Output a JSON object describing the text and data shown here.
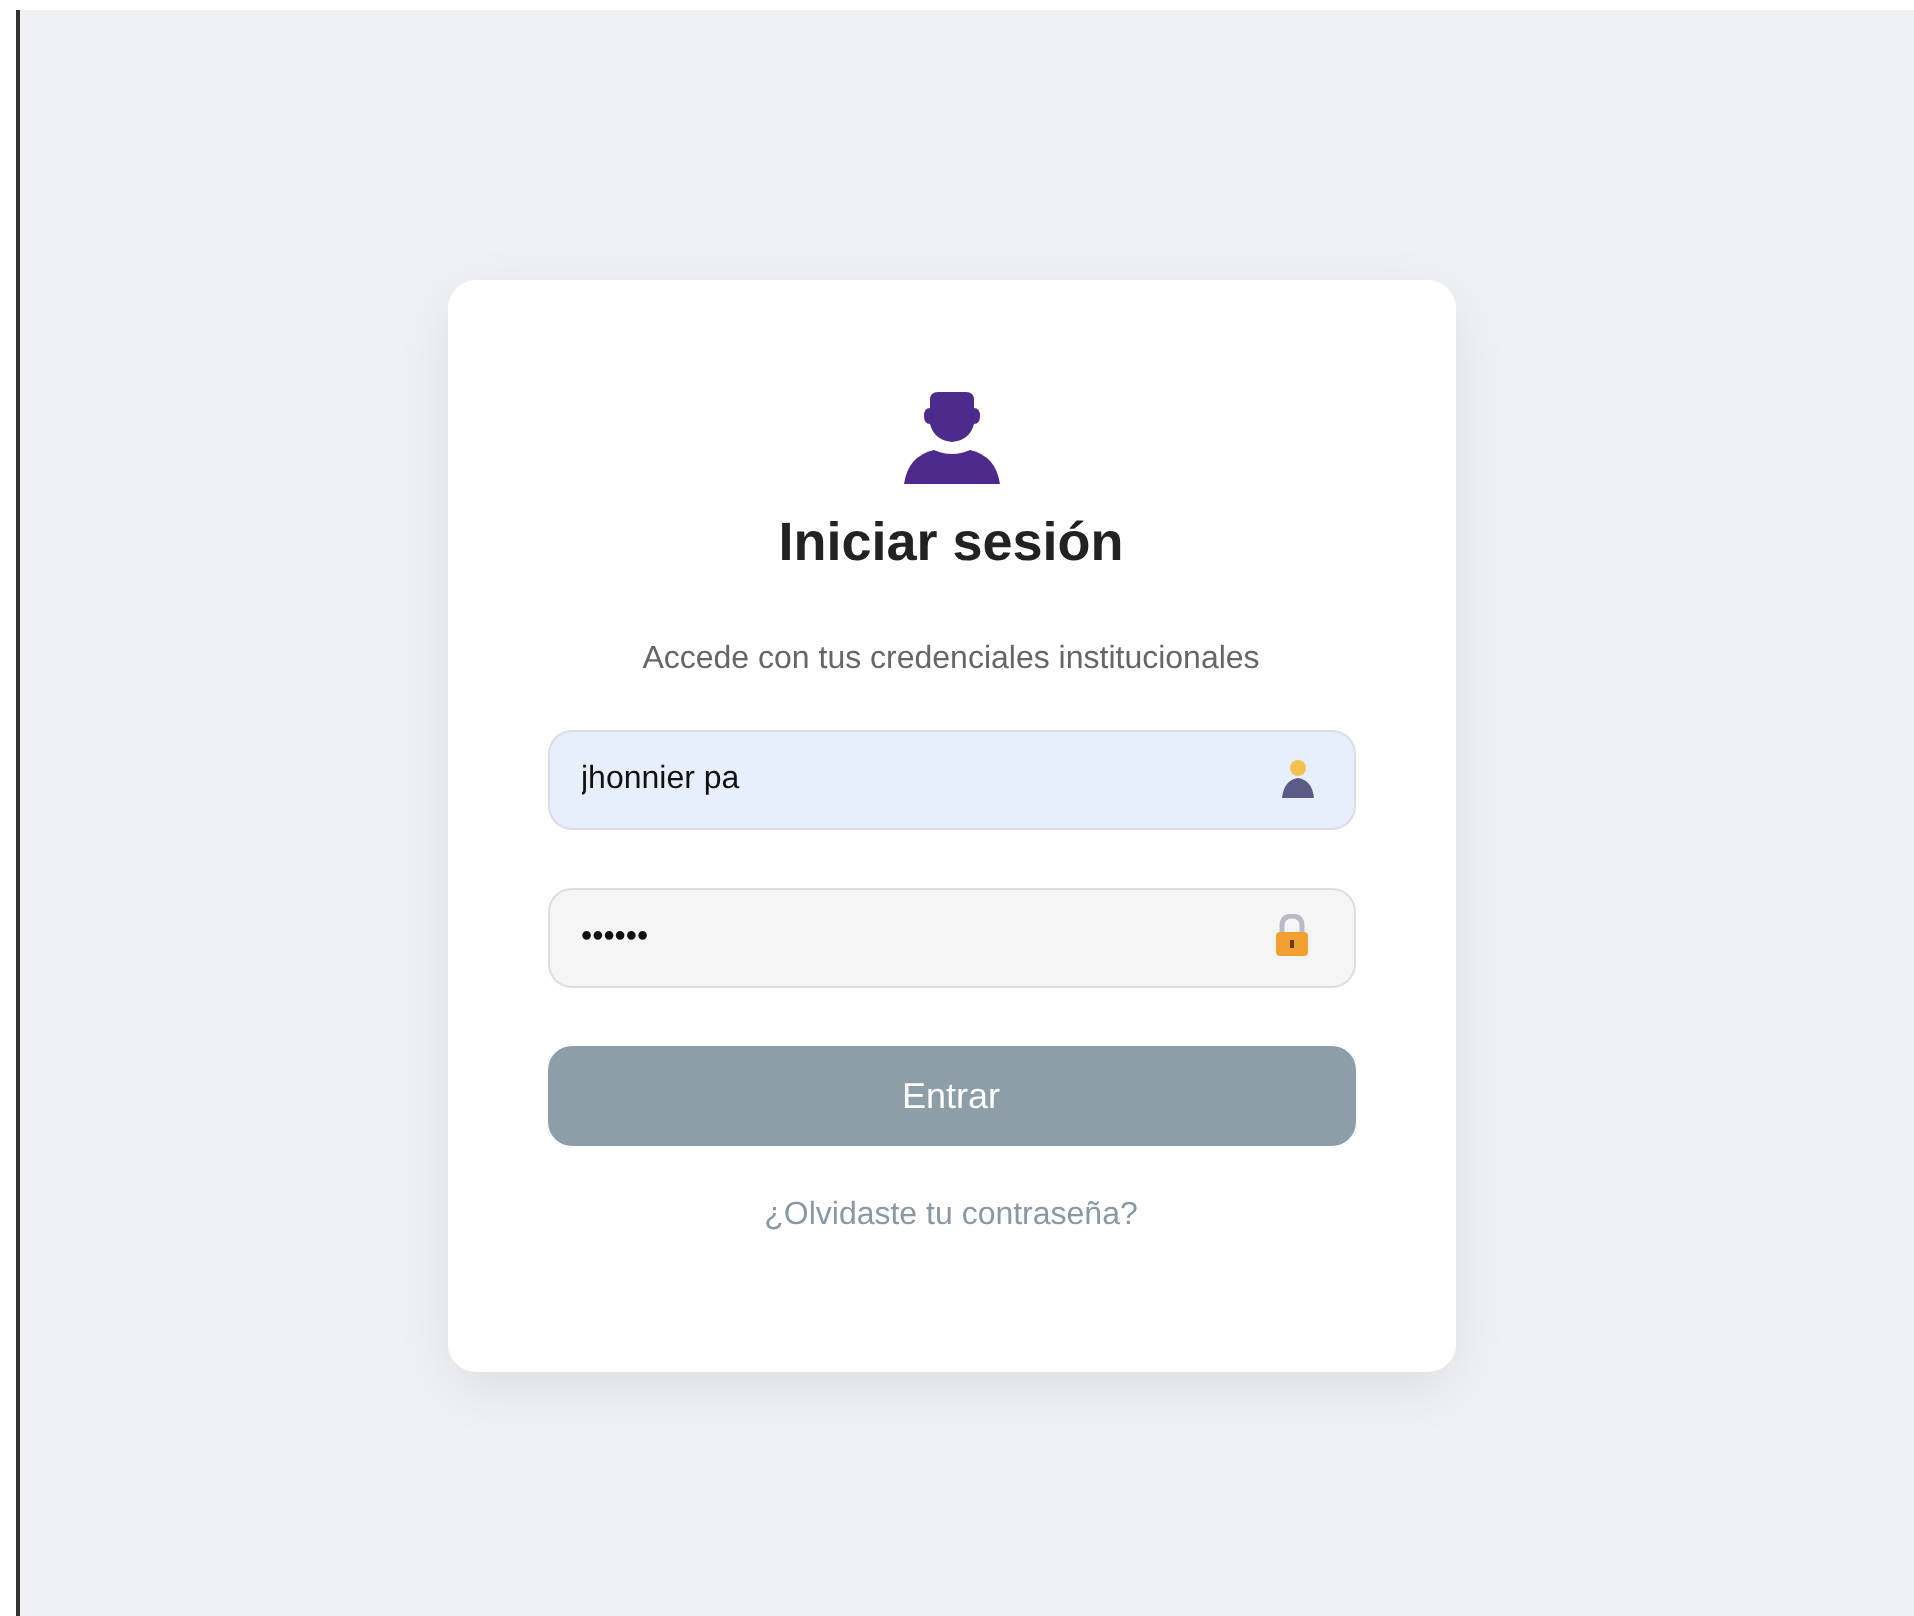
{
  "login": {
    "title": "Iniciar sesión",
    "subtitle": "Accede con tus credenciales institucionales",
    "username": {
      "value": "jhonnier pa"
    },
    "password": {
      "value": "••••••"
    },
    "submit": {
      "label": "Entrar",
      "disabled": true
    },
    "forgot_link": "¿Olvidaste tu contraseña?"
  }
}
